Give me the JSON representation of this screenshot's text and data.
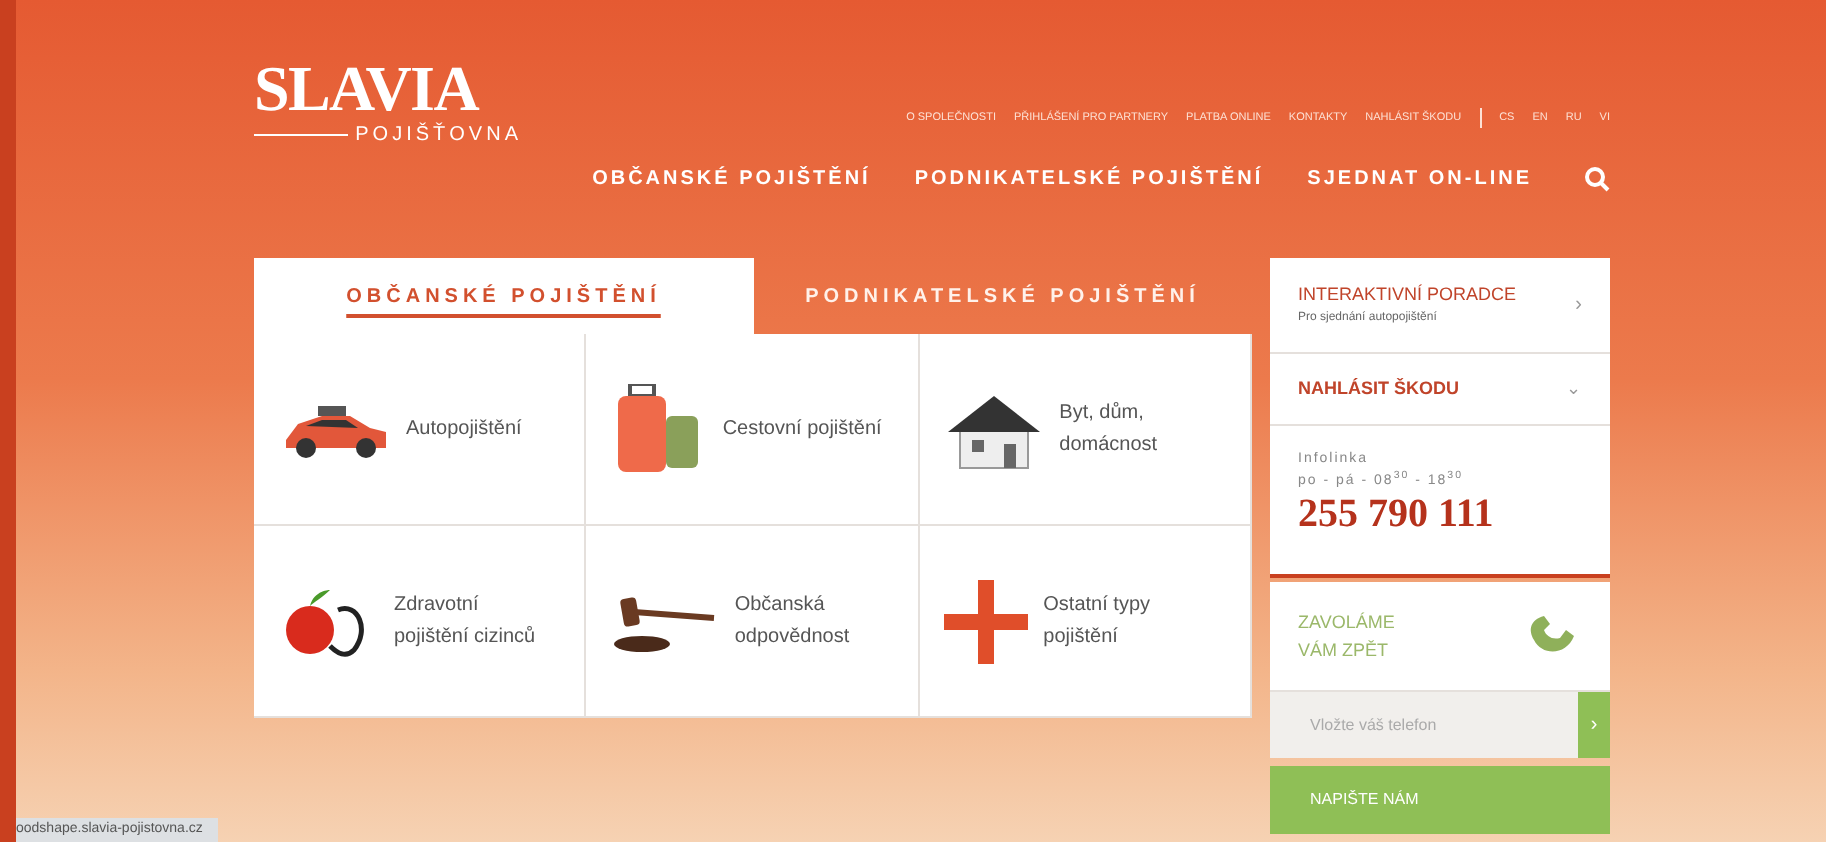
{
  "logo": {
    "name": "SLAVIA",
    "subtitle": "POJIŠŤOVNA"
  },
  "top_links": [
    {
      "label": "O SPOLEČNOSTI"
    },
    {
      "label": "PŘIHLÁŠENÍ PRO PARTNERY"
    },
    {
      "label": "PLATBA ONLINE"
    },
    {
      "label": "KONTAKTY"
    },
    {
      "label": "NAHLÁSIT ŠKODU"
    }
  ],
  "languages": [
    {
      "label": "CS"
    },
    {
      "label": "EN"
    },
    {
      "label": "RU"
    },
    {
      "label": "VI"
    }
  ],
  "main_nav": [
    {
      "label": "OBČANSKÉ POJIŠTĚNÍ"
    },
    {
      "label": "PODNIKATELSKÉ POJIŠTĚNÍ"
    },
    {
      "label": "SJEDNAT ON-LINE"
    }
  ],
  "tabs": [
    {
      "label": "OBČANSKÉ POJIŠTĚNÍ",
      "selected": true
    },
    {
      "label": "PODNIKATELSKÉ POJIŠTĚNÍ",
      "selected": false
    }
  ],
  "products": [
    {
      "kind": "car",
      "label": "Autopojištění"
    },
    {
      "kind": "luggage",
      "label": "Cestovní pojištění"
    },
    {
      "kind": "house",
      "label": "Byt, dům, domácnost"
    },
    {
      "kind": "health",
      "label": "Zdravotní pojištění cizinců"
    },
    {
      "kind": "gavel",
      "label": "Občanská odpovědnost"
    },
    {
      "kind": "plus",
      "label": "Ostatní typy pojištění"
    }
  ],
  "side_panel": {
    "advisor": {
      "title": "INTERAKTIVNÍ PORADCE",
      "subtitle": "Pro sjednání autopojištění",
      "arrow": "›"
    },
    "report": {
      "title": "NAHLÁSIT ŠKODU",
      "arrow": "⌄"
    },
    "infoline": {
      "label": "Infolinka",
      "hours": "po - pá - 08$^{30}$ - 18$^{30}$",
      "phone": "255 790 111"
    },
    "callback": {
      "title_line1": "ZAVOLÁME",
      "title_line2": "VÁM ZPĚT",
      "placeholder": "Vložte váš telefon",
      "submit": "›"
    },
    "write": {
      "label": "NAPIŠTE NÁM"
    }
  },
  "status_bar": {
    "url": "oodshape.slavia-pojistovna.cz"
  }
}
